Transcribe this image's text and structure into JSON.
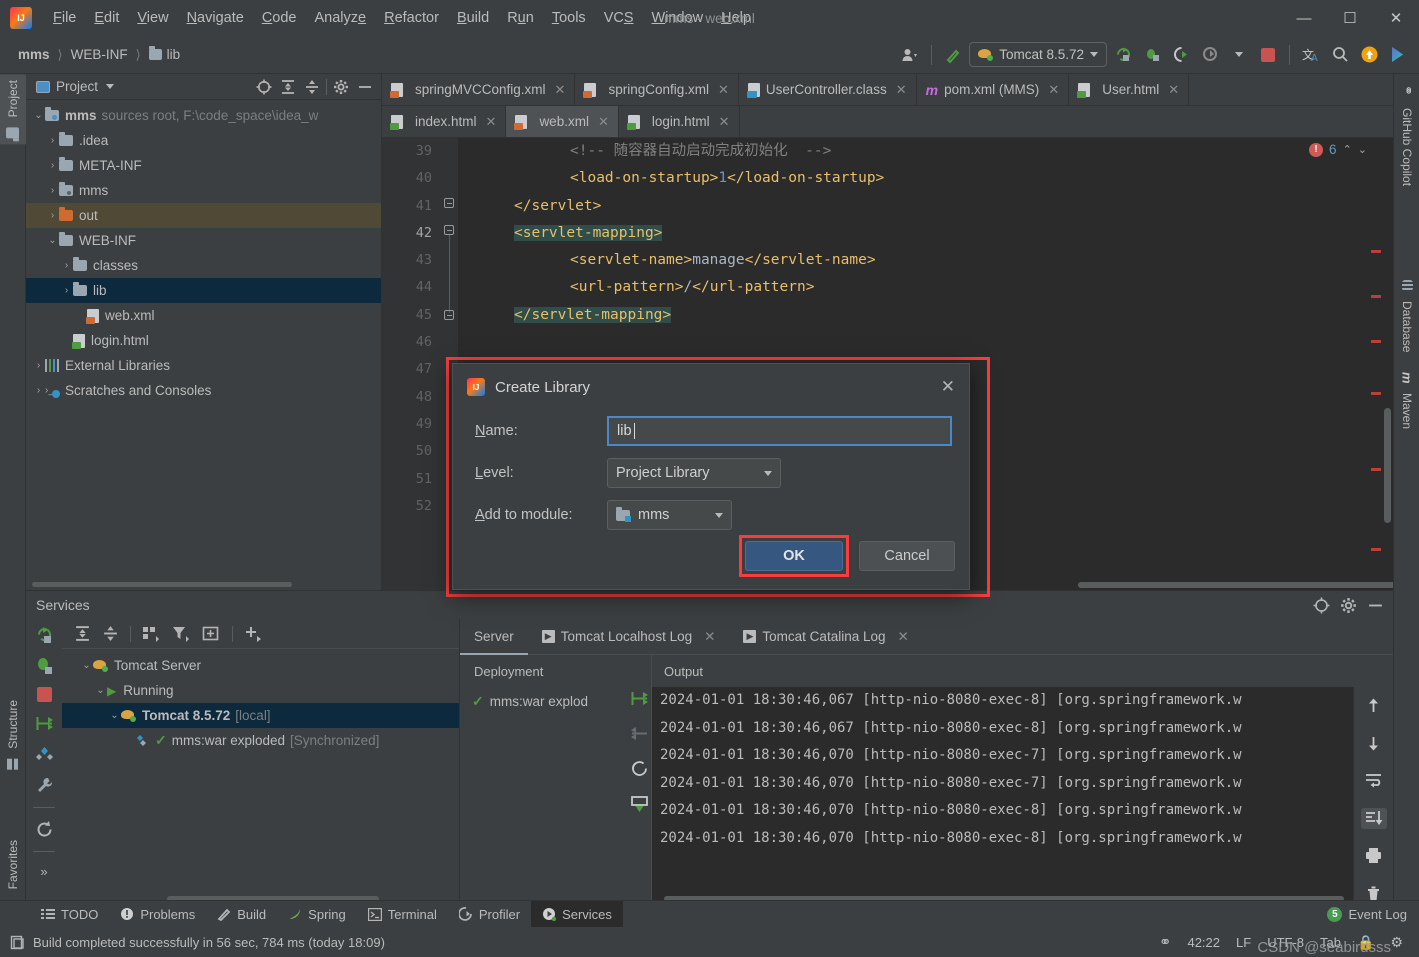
{
  "window": {
    "title": "mms - web.xml",
    "minimize": "—",
    "maximize": "☐",
    "close": "✕"
  },
  "menubar": [
    {
      "label": "File"
    },
    {
      "label": "Edit"
    },
    {
      "label": "View"
    },
    {
      "label": "Navigate"
    },
    {
      "label": "Code"
    },
    {
      "label": "Analyze"
    },
    {
      "label": "Refactor"
    },
    {
      "label": "Build"
    },
    {
      "label": "Run"
    },
    {
      "label": "Tools"
    },
    {
      "label": "VCS"
    },
    {
      "label": "Window"
    },
    {
      "label": "Help"
    }
  ],
  "navbar": {
    "breadcrumbs": [
      {
        "label": "mms",
        "icon": ""
      },
      {
        "label": "WEB-INF",
        "icon": ""
      },
      {
        "label": "lib",
        "icon": "folder-icon"
      }
    ],
    "separator": "〉",
    "run_config": "Tomcat 8.5.72"
  },
  "left_strip": [
    {
      "label": "Project",
      "icon": "project-folder-icon",
      "active": true
    },
    {
      "label": "Structure",
      "icon": "structure-icon",
      "active": false
    },
    {
      "label": "Favorites",
      "icon": "star-icon",
      "active": false
    }
  ],
  "right_strip": [
    {
      "label": "GitHub Copilot",
      "icon": "copilot-icon"
    },
    {
      "label": "Database",
      "icon": "database-icon"
    },
    {
      "label": "Maven",
      "icon": "maven-icon"
    }
  ],
  "project_panel": {
    "title": "Project",
    "tree": [
      {
        "indent": 0,
        "arrow": "⌄",
        "icon": "module-folder-icon",
        "label": "mms",
        "bold": true,
        "suffix": "sources root,  F:\\code_space\\idea_w",
        "state": "normal"
      },
      {
        "indent": 1,
        "arrow": "›",
        "icon": "folder-icon",
        "label": ".idea",
        "bold": false,
        "suffix": "",
        "state": "normal"
      },
      {
        "indent": 1,
        "arrow": "›",
        "icon": "folder-icon",
        "label": "META-INF",
        "bold": false,
        "suffix": "",
        "state": "normal"
      },
      {
        "indent": 1,
        "arrow": "›",
        "icon": "folder-dot-icon",
        "label": "mms",
        "bold": false,
        "suffix": "",
        "state": "normal"
      },
      {
        "indent": 1,
        "arrow": "›",
        "icon": "folder-orange-icon",
        "label": "out",
        "bold": false,
        "suffix": "",
        "state": "highlight"
      },
      {
        "indent": 1,
        "arrow": "⌄",
        "icon": "folder-icon",
        "label": "WEB-INF",
        "bold": false,
        "suffix": "",
        "state": "normal"
      },
      {
        "indent": 2,
        "arrow": "›",
        "icon": "folder-icon",
        "label": "classes",
        "bold": false,
        "suffix": "",
        "state": "normal"
      },
      {
        "indent": 2,
        "arrow": "›",
        "icon": "folder-icon",
        "label": "lib",
        "bold": false,
        "suffix": "",
        "state": "selected"
      },
      {
        "indent": 3,
        "arrow": "",
        "icon": "xml-file-icon",
        "label": "web.xml",
        "bold": false,
        "suffix": "",
        "state": "normal"
      },
      {
        "indent": 2,
        "arrow": "",
        "icon": "html-file-icon",
        "label": "login.html",
        "bold": false,
        "suffix": "",
        "state": "normal"
      },
      {
        "indent": 0,
        "arrow": "›",
        "icon": "libraries-icon",
        "label": "External Libraries",
        "bold": false,
        "suffix": "",
        "state": "normal"
      },
      {
        "indent": 0,
        "arrow": "›",
        "icon": "scratches-icon",
        "label": "Scratches and Consoles",
        "bold": false,
        "suffix": "",
        "state": "normal"
      }
    ]
  },
  "editor": {
    "tabs_row1": [
      {
        "label": "springMVCConfig.xml",
        "icon": "xml-file-icon",
        "active": false
      },
      {
        "label": "springConfig.xml",
        "icon": "xml-file-icon",
        "active": false
      },
      {
        "label": "UserController.class",
        "icon": "class-file-icon",
        "active": false
      },
      {
        "label": "pom.xml (MMS)",
        "icon": "maven-file-icon",
        "active": false
      },
      {
        "label": "User.html",
        "icon": "html-file-icon",
        "active": false
      }
    ],
    "tabs_row2": [
      {
        "label": "index.html",
        "icon": "html-file-icon",
        "active": false
      },
      {
        "label": "web.xml",
        "icon": "xml-file-icon",
        "active": true
      },
      {
        "label": "login.html",
        "icon": "html-file-icon",
        "active": false
      }
    ],
    "close_glyph": "✕",
    "error_count": "6",
    "error_glyph": "!",
    "chev_up": "⌃",
    "chev_down": "⌄",
    "lines": [
      {
        "num": "39",
        "indent": 8,
        "highlight": false,
        "segments": [
          {
            "t": "<!-- 随容器自动启动完成初始化  -->",
            "c": "cmt"
          }
        ]
      },
      {
        "num": "40",
        "indent": 8,
        "highlight": false,
        "segments": [
          {
            "t": "<load-on-startup>",
            "c": "tag"
          },
          {
            "t": "1",
            "c": "num"
          },
          {
            "t": "</load-on-startup>",
            "c": "tag"
          }
        ]
      },
      {
        "num": "41",
        "indent": 4,
        "highlight": false,
        "segments": [
          {
            "t": "</servlet>",
            "c": "tag"
          }
        ]
      },
      {
        "num": "42",
        "indent": 4,
        "highlight": true,
        "segments": [
          {
            "t": "<servlet-mapping>",
            "c": "tag"
          }
        ]
      },
      {
        "num": "43",
        "indent": 8,
        "highlight": false,
        "segments": [
          {
            "t": "<servlet-name>",
            "c": "tag"
          },
          {
            "t": "manage",
            "c": "val"
          },
          {
            "t": "</servlet-name>",
            "c": "tag"
          }
        ]
      },
      {
        "num": "44",
        "indent": 8,
        "highlight": false,
        "segments": [
          {
            "t": "<url-pattern>",
            "c": "tag"
          },
          {
            "t": "/",
            "c": "val"
          },
          {
            "t": "</url-pattern>",
            "c": "tag"
          }
        ]
      },
      {
        "num": "45",
        "indent": 4,
        "highlight": true,
        "segments": [
          {
            "t": "</servlet-mapping>",
            "c": "tag"
          }
        ]
      },
      {
        "num": "46",
        "indent": 0,
        "highlight": false,
        "segments": []
      },
      {
        "num": "47",
        "indent": 0,
        "highlight": false,
        "segments": []
      },
      {
        "num": "48",
        "indent": 0,
        "highlight": false,
        "segments": []
      },
      {
        "num": "49",
        "indent": 0,
        "highlight": false,
        "segments": []
      },
      {
        "num": "50",
        "indent": 0,
        "highlight": false,
        "segments": []
      },
      {
        "num": "51",
        "indent": 0,
        "highlight": false,
        "segments": []
      },
      {
        "num": "52",
        "indent": 0,
        "highlight": false,
        "segments": []
      }
    ]
  },
  "dialog": {
    "title": "Create Library",
    "close_glyph": "✕",
    "name_label_pre": "N",
    "name_label_rest": "ame:",
    "name_value": "lib",
    "level_label_pre": "L",
    "level_label_rest": "evel:",
    "level_value": "Project Library",
    "module_label_pre": "A",
    "module_label_rest": "dd to module:",
    "module_value": "mms",
    "ok_label": "OK",
    "cancel_label": "Cancel"
  },
  "services": {
    "title": "Services",
    "tree": [
      {
        "indent": 0,
        "arrow": "⌄",
        "icon": "tomcat-icon",
        "label": "Tomcat Server",
        "suffix": "",
        "bold": false,
        "selected": false
      },
      {
        "indent": 1,
        "arrow": "⌄",
        "icon": "run-icon",
        "label": "Running",
        "suffix": "",
        "bold": false,
        "selected": false
      },
      {
        "indent": 2,
        "arrow": "⌄",
        "icon": "tomcat-run-icon",
        "label": "Tomcat 8.5.72",
        "suffix": "[local]",
        "bold": true,
        "selected": true
      },
      {
        "indent": 3,
        "arrow": "",
        "icon": "artifact-icon",
        "label": "mms:war exploded",
        "suffix": "[Synchronized]",
        "bold": false,
        "selected": false
      }
    ],
    "tabs": [
      {
        "label": "Server",
        "icon": "",
        "active": true,
        "closable": false
      },
      {
        "label": "Tomcat Localhost Log",
        "icon": "log-icon",
        "active": false,
        "closable": true
      },
      {
        "label": "Tomcat Catalina Log",
        "icon": "log-icon",
        "active": false,
        "closable": true
      }
    ],
    "close_glyph": "✕",
    "col_deployment": "Deployment",
    "col_output": "Output",
    "deployment_item": "mms:war explod",
    "log_lines": [
      "2024-01-01 18:30:46,067 [http-nio-8080-exec-8] [org.springframework.w",
      "2024-01-01 18:30:46,067 [http-nio-8080-exec-8] [org.springframework.w",
      "2024-01-01 18:30:46,070 [http-nio-8080-exec-7] [org.springframework.w",
      "2024-01-01 18:30:46,070 [http-nio-8080-exec-7] [org.springframework.w",
      "2024-01-01 18:30:46,070 [http-nio-8080-exec-8] [org.springframework.w",
      "2024-01-01 18:30:46,070 [http-nio-8080-exec-8] [org.springframework.w"
    ]
  },
  "bottom_bar": {
    "windows": [
      {
        "label": "TODO",
        "icon": "todo-icon",
        "active": false
      },
      {
        "label": "Problems",
        "icon": "problems-icon",
        "active": false
      },
      {
        "label": "Build",
        "icon": "build-icon",
        "active": false
      },
      {
        "label": "Spring",
        "icon": "spring-icon",
        "active": false
      },
      {
        "label": "Terminal",
        "icon": "terminal-icon",
        "active": false
      },
      {
        "label": "Profiler",
        "icon": "profiler-icon",
        "active": false
      },
      {
        "label": "Services",
        "icon": "services-icon",
        "active": true
      }
    ],
    "event_log": "Event Log",
    "event_count": "5"
  },
  "status_bar": {
    "message": "Build completed successfully in 56 sec, 784 ms (today 18:09)",
    "caret": "42:22",
    "line_sep": "LF",
    "encoding": "UTF-8",
    "indent": "Tab",
    "watermark": "CSDN @seabirdsss"
  }
}
